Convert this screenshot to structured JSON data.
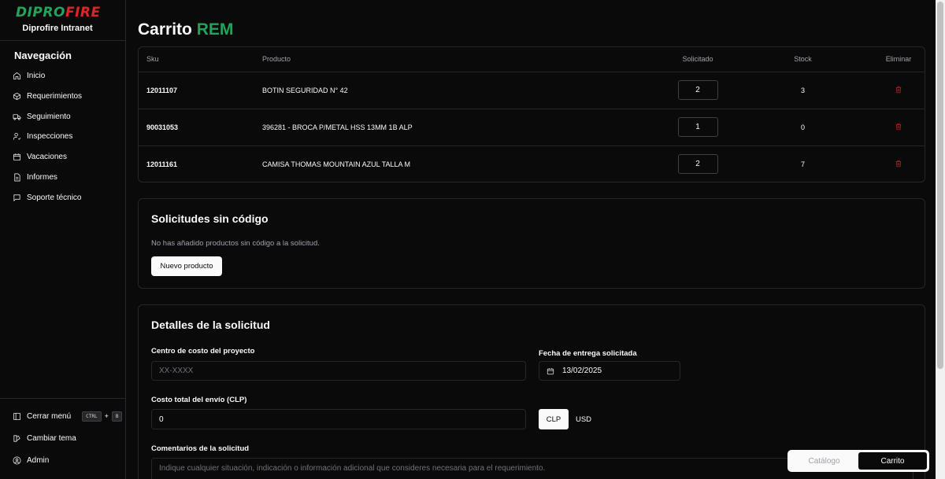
{
  "app": {
    "logo_green": "DIPRO",
    "logo_red": "FIRE",
    "brand": "Diprofire Intranet",
    "colors": {
      "accent": "#22a35a",
      "danger": "#dc2626",
      "background": "#0a0a0a"
    }
  },
  "sidebar": {
    "title": "Navegación",
    "items": [
      {
        "label": "Inicio",
        "icon": "home-icon"
      },
      {
        "label": "Requerimientos",
        "icon": "box-icon"
      },
      {
        "label": "Seguimiento",
        "icon": "truck-icon"
      },
      {
        "label": "Inspecciones",
        "icon": "user-check-icon"
      },
      {
        "label": "Vacaciones",
        "icon": "calendar-icon"
      },
      {
        "label": "Informes",
        "icon": "file-icon"
      },
      {
        "label": "Soporte técnico",
        "icon": "message-icon"
      }
    ],
    "footer": {
      "collapse_label": "Cerrar menú",
      "shortcut_key1": "CTRL",
      "shortcut_plus": "+",
      "shortcut_key2": "B",
      "theme_label": "Cambiar tema",
      "admin_label": "Admin"
    }
  },
  "page": {
    "title": "Carrito",
    "title_accent": "REM"
  },
  "cart_table": {
    "columns": [
      "Sku",
      "Producto",
      "Solicitado",
      "Stock",
      "Eliminar"
    ],
    "rows": [
      {
        "sku": "12011107",
        "product": "BOTIN SEGURIDAD N° 42",
        "requested": "2",
        "stock": "3"
      },
      {
        "sku": "90031053",
        "product": "396281 - BROCA P/METAL HSS 13MM 1B ALP",
        "requested": "1",
        "stock": "0"
      },
      {
        "sku": "12011161",
        "product": "CAMISA THOMAS MOUNTAIN AZUL TALLA M",
        "requested": "2",
        "stock": "7"
      }
    ]
  },
  "no_code": {
    "title": "Solicitudes sin código",
    "empty_text": "No has añadido productos sin código a la solicitud.",
    "new_button": "Nuevo producto"
  },
  "details": {
    "title": "Detalles de la solicitud",
    "cost_center_label": "Centro de costo del proyecto",
    "cost_center_placeholder": "XX-XXXX",
    "delivery_label": "Fecha de entrega solicitada",
    "delivery_value": "13/02/2025",
    "shipping_label": "Costo total del envío (CLP)",
    "shipping_value": "0",
    "currency_options": [
      "CLP",
      "USD"
    ],
    "currency_selected": "CLP",
    "comments_label": "Comentarios de la solicitud",
    "comments_placeholder": "Indique cualquier situación, indicación o información adicional que consideres necesaria para el requerimiento."
  },
  "view_switch": {
    "catalog_label": "Catálogo",
    "cart_label": "Carrito",
    "active": "Carrito"
  }
}
